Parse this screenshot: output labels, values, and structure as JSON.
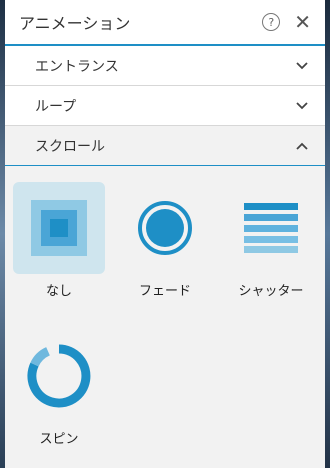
{
  "panel": {
    "title": "アニメーション"
  },
  "sections": [
    {
      "label": "エントランス"
    },
    {
      "label": "ループ"
    },
    {
      "label": "スクロール"
    }
  ],
  "options": [
    {
      "label": "なし",
      "icon": "none-icon"
    },
    {
      "label": "フェード",
      "icon": "fade-icon"
    },
    {
      "label": "シャッター",
      "icon": "shutter-icon"
    },
    {
      "label": "スピン",
      "icon": "spin-icon"
    }
  ],
  "colors": {
    "accent": "#1e8fc6",
    "selected_bg": "#cfe5ee"
  }
}
